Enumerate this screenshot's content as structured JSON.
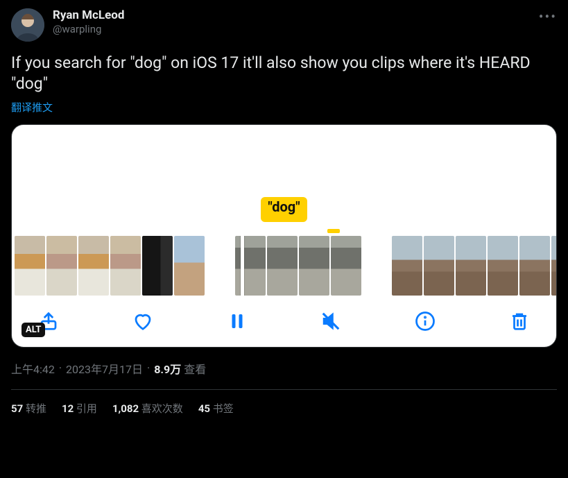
{
  "author": {
    "display_name": "Ryan McLeod",
    "handle": "@warpling"
  },
  "more_label": "•••",
  "body_text": "If you search for \"dog\" on iOS 17 it'll also show you clips where it's HEARD \"dog\"",
  "translate_label": "翻译推文",
  "media": {
    "keyword_label": "\"dog\"",
    "alt_badge": "ALT",
    "controls": {
      "share": "share",
      "like": "like",
      "pause": "pause",
      "mute": "mute",
      "info": "info",
      "delete": "delete"
    }
  },
  "meta": {
    "time": "上午4:42",
    "date": "2023年7月17日",
    "views_count": "8.9万",
    "views_label": "查看"
  },
  "engagement": {
    "retweets": {
      "count": "57",
      "label": "转推"
    },
    "quotes": {
      "count": "12",
      "label": "引用"
    },
    "likes": {
      "count": "1,082",
      "label": "喜欢次数"
    },
    "bookmarks": {
      "count": "45",
      "label": "书签"
    }
  }
}
